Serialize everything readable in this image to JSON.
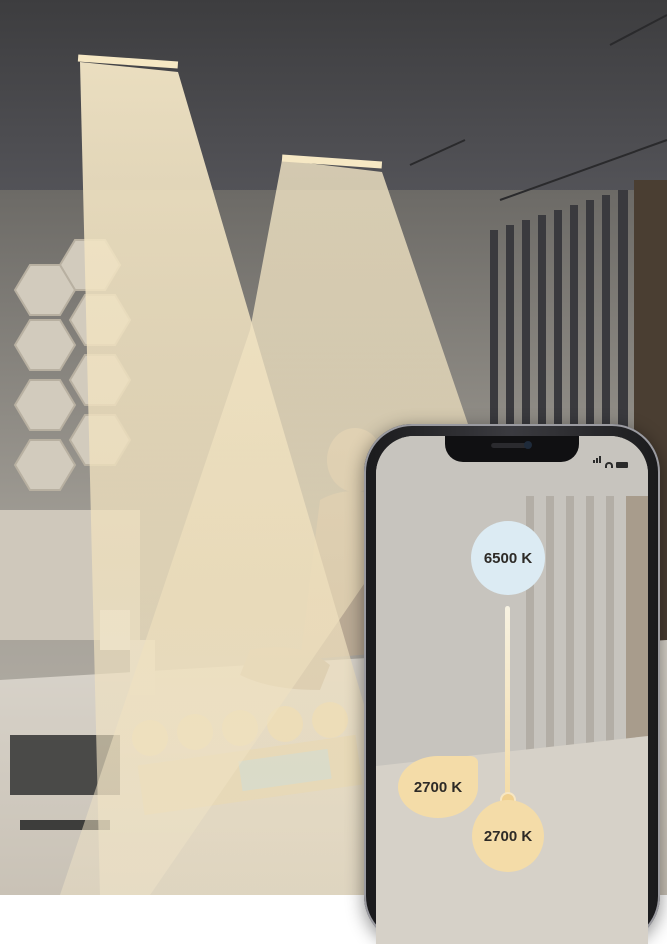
{
  "phone_app": {
    "cool_temperature": "6500 K",
    "warm_temperature_1": "2700 K",
    "warm_temperature_2": "2700 K"
  },
  "colors": {
    "cool_bubble": "#dcebf3",
    "warm_bubble": "#f4dca8",
    "light_beam": "#f2e4c4"
  }
}
